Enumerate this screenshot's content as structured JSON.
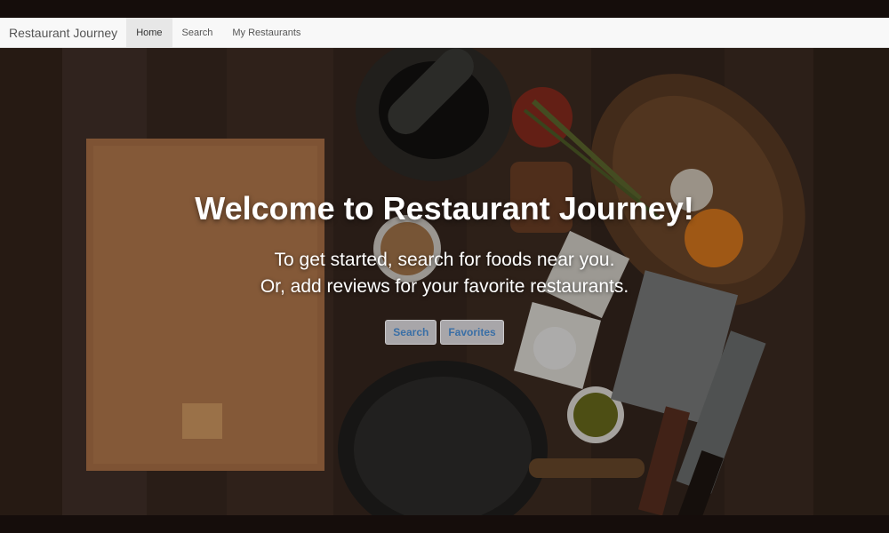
{
  "navbar": {
    "brand": "Restaurant Journey",
    "links": [
      {
        "label": "Home",
        "active": true
      },
      {
        "label": "Search",
        "active": false
      },
      {
        "label": "My Restaurants",
        "active": false
      }
    ]
  },
  "hero": {
    "title": "Welcome to Restaurant Journey!",
    "line1": "To get started, search for foods near you.",
    "line2": "Or, add reviews for your favorite restaurants.",
    "buttons": {
      "search": "Search",
      "favorites": "Favorites"
    },
    "background_image": "kitchen-table-flatlay"
  },
  "colors": {
    "navbar_bg": "#f8f8f8",
    "button_text": "#3a6fa6",
    "hero_text": "#ffffff"
  }
}
